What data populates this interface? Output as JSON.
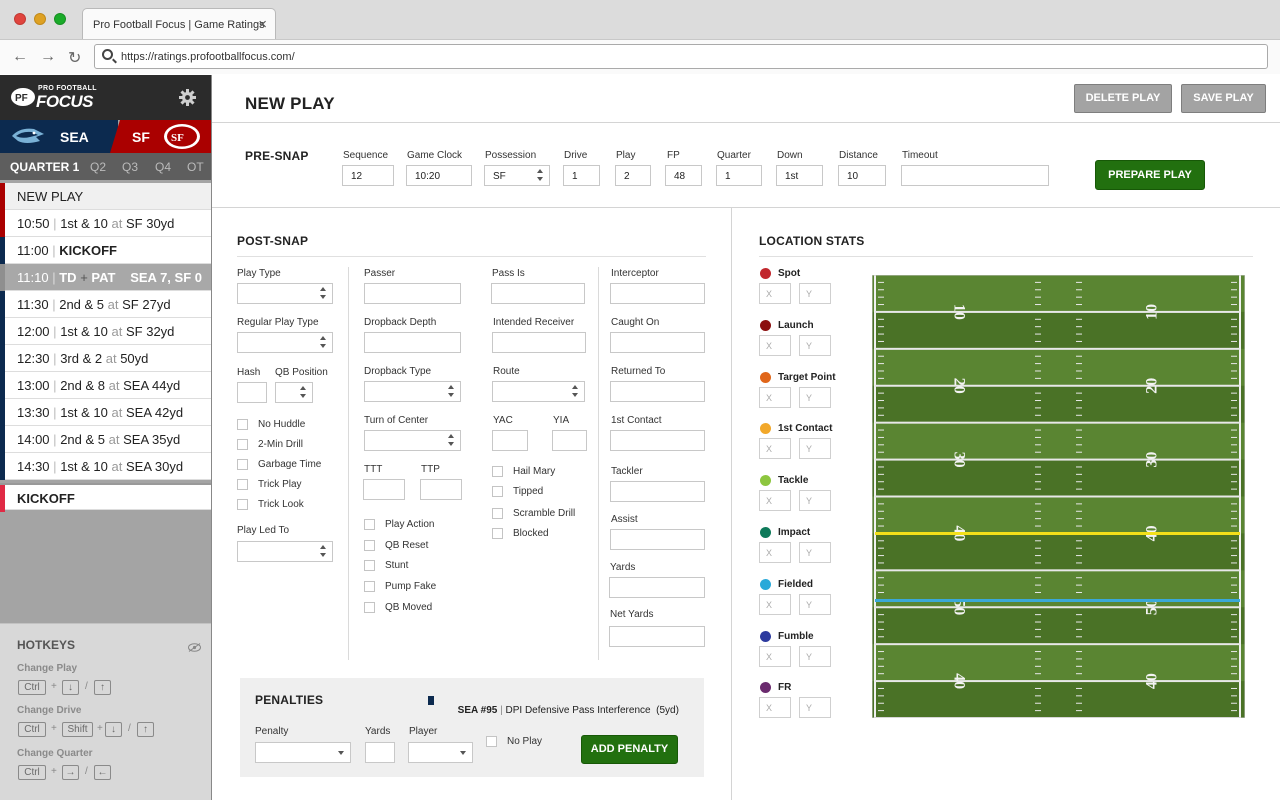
{
  "browser": {
    "tab_title": "Pro Football Focus | Game Ratings",
    "tab_close": "×",
    "url": "https://ratings.profootballfocus.com/"
  },
  "sidebar": {
    "logo_small": "PRO FOOTBALL",
    "logo_big": "FOCUS",
    "teams": {
      "home": {
        "abbr": "SEA",
        "color": "#0c2a4f"
      },
      "away": {
        "abbr": "SF",
        "color": "#aa0000"
      }
    },
    "quarters": [
      {
        "label": "QUARTER 1",
        "active": true
      },
      {
        "label": "Q2",
        "active": false
      },
      {
        "label": "Q3",
        "active": false
      },
      {
        "label": "Q4",
        "active": false
      },
      {
        "label": "OT",
        "active": false
      }
    ],
    "new_play": "NEW PLAY",
    "plays": [
      {
        "time": "10:50",
        "down": "1st & 10",
        "at": "at",
        "spot": "SF 30yd"
      },
      {
        "time": "11:00",
        "event": "KICKOFF"
      },
      {
        "time": "11:10",
        "td": "TD",
        "plus": "+",
        "pat": "PAT",
        "score": "SEA 7, SF 0"
      },
      {
        "time": "11:30",
        "down": "2nd & 5",
        "at": "at",
        "spot": "SF 27yd"
      },
      {
        "time": "12:00",
        "down": "1st & 10",
        "at": "at",
        "spot": "SF 32yd"
      },
      {
        "time": "12:30",
        "down": "3rd & 2",
        "at": "at",
        "spot": "50yd"
      },
      {
        "time": "13:00",
        "down": "2nd & 8",
        "at": "at",
        "spot": "SEA 44yd"
      },
      {
        "time": "13:30",
        "down": "1st & 10",
        "at": "at",
        "spot": "SEA 42yd"
      },
      {
        "time": "14:00",
        "down": "2nd & 5",
        "at": "at",
        "spot": "SEA 35yd"
      },
      {
        "time": "14:30",
        "down": "1st & 10",
        "at": "at",
        "spot": "SEA 30yd"
      }
    ],
    "drive_kickoff": "KICKOFF",
    "hotkeys": {
      "title": "HOTKEYS",
      "change_play": "Change Play",
      "change_drive": "Change Drive",
      "change_quarter": "Change Quarter",
      "ctrl": "Ctrl",
      "shift": "Shift",
      "plus": "+",
      "slash": "/",
      "down": "↓",
      "up": "↑",
      "right": "→",
      "left": "←"
    }
  },
  "header": {
    "title": "NEW PLAY",
    "delete": "DELETE PLAY",
    "save": "SAVE PLAY"
  },
  "presnap": {
    "title": "PRE-SNAP",
    "sequence": {
      "label": "Sequence",
      "value": "12"
    },
    "clock": {
      "label": "Game Clock",
      "value": "10:20"
    },
    "possession": {
      "label": "Possession",
      "value": "SF"
    },
    "drive": {
      "label": "Drive",
      "value": "1"
    },
    "play": {
      "label": "Play",
      "value": "2"
    },
    "fp": {
      "label": "FP",
      "value": "48"
    },
    "quarter": {
      "label": "Quarter",
      "value": "1"
    },
    "down": {
      "label": "Down",
      "value": "1st"
    },
    "distance": {
      "label": "Distance",
      "value": "10"
    },
    "timeout": {
      "label": "Timeout",
      "value": ""
    },
    "prepare": "PREPARE PLAY"
  },
  "postsnap": {
    "title": "POST-SNAP",
    "play_type": "Play Type",
    "regular_play_type": "Regular Play Type",
    "hash": "Hash",
    "qb_position": "QB Position",
    "checks1": [
      "No Huddle",
      "2-Min Drill",
      "Garbage Time",
      "Trick Play",
      "Trick Look"
    ],
    "play_led_to": "Play Led To",
    "passer": "Passer",
    "dropback_depth": "Dropback Depth",
    "dropback_type": "Dropback Type",
    "turn_of_center": "Turn of Center",
    "ttt": "TTT",
    "ttp": "TTP",
    "checks2": [
      "Play Action",
      "QB Reset",
      "Stunt",
      "Pump Fake",
      "QB Moved"
    ],
    "pass_is": "Pass Is",
    "intended_receiver": "Intended Receiver",
    "route": "Route",
    "yac": "YAC",
    "yia": "YIA",
    "checks3": [
      "Hail Mary",
      "Tipped",
      "Scramble Drill",
      "Blocked"
    ],
    "interceptor": "Interceptor",
    "caught_on": "Caught On",
    "returned_to": "Returned To",
    "first_contact": "1st Contact",
    "tackler": "Tackler",
    "assist": "Assist",
    "yards": "Yards",
    "net_yards": "Net Yards"
  },
  "penalties": {
    "title": "PENALTIES",
    "summary_team": "SEA #95",
    "summary_sep": "|",
    "summary_desc": "DPI Defensive Pass Interference  (5yd)",
    "penalty": "Penalty",
    "yards": "Yards",
    "player": "Player",
    "no_play": "No Play",
    "add": "ADD PENALTY"
  },
  "location": {
    "title": "LOCATION STATS",
    "x": "X",
    "y": "Y",
    "items": [
      {
        "name": "Spot",
        "color": "#c1272d"
      },
      {
        "name": "Launch",
        "color": "#8b0f0f"
      },
      {
        "name": "Target Point",
        "color": "#e0661a"
      },
      {
        "name": "1st Contact",
        "color": "#f2a82a"
      },
      {
        "name": "Tackle",
        "color": "#8dc63f"
      },
      {
        "name": "Impact",
        "color": "#0e7a5a"
      },
      {
        "name": "Fielded",
        "color": "#29a9d9"
      },
      {
        "name": "Fumble",
        "color": "#2c3a9e"
      },
      {
        "name": "FR",
        "color": "#6a2a6e"
      }
    ],
    "field": {
      "numbers_left": [
        "10",
        "20",
        "30",
        "40",
        "50",
        "40"
      ],
      "numbers_right": [
        "10",
        "20",
        "30",
        "40",
        "50",
        "40"
      ],
      "yellow_line_color": "#f3e01a",
      "blue_line_color": "#3aa8d8"
    }
  }
}
